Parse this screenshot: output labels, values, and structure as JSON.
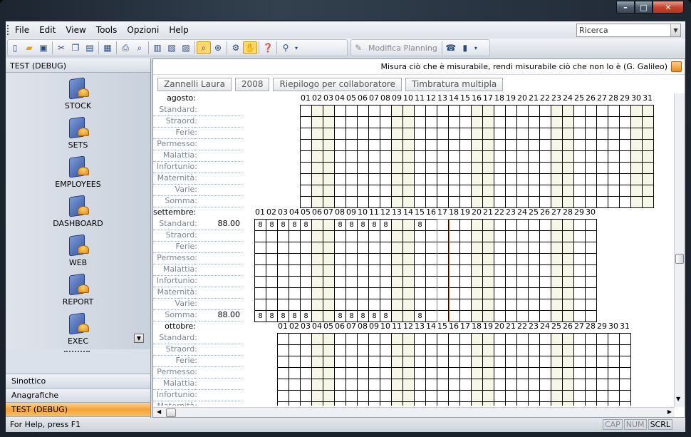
{
  "window": {
    "title": ""
  },
  "menu": [
    "File",
    "Edit",
    "View",
    "Tools",
    "Opzioni",
    "Help"
  ],
  "search": {
    "value": "Ricerca"
  },
  "toolbar": {
    "modifica_planning": "Modifica Planning"
  },
  "left": {
    "header": "TEST (DEBUG)",
    "items": [
      "STOCK",
      "SETS",
      "EMPLOYEES",
      "DASHBOARD",
      "WEB",
      "REPORT",
      "EXEC"
    ],
    "nav": [
      "Sinottico",
      "Anagrafiche",
      "TEST (DEBUG)"
    ],
    "footer": "»"
  },
  "main": {
    "quote": "Misura ciò che è misurabile, rendi misurabile ciò che non lo è (G. Galileo)",
    "buttons": [
      "Zannelli Laura",
      "2008",
      "Riepilogo per collaboratore",
      "Timbratura multipla"
    ],
    "row_labels": [
      "Standard:",
      "Straord:",
      "Ferie:",
      "Permesso:",
      "Malattia:",
      "Infortunio:",
      "Maternità:",
      "Varie:",
      "Somma:"
    ],
    "months": [
      {
        "name": "agosto:",
        "days": 31,
        "standard_total": "",
        "somma_total": "",
        "weekend": [
          2,
          3,
          9,
          10,
          16,
          17,
          23,
          24,
          30,
          31
        ],
        "today": null,
        "values": {}
      },
      {
        "name": "settembre:",
        "days": 30,
        "standard_total": "88.00",
        "somma_total": "88.00",
        "weekend": [
          6,
          7,
          13,
          14,
          20,
          21,
          27,
          28
        ],
        "today": 17,
        "values": {
          "1": "8",
          "2": "8",
          "3": "8",
          "4": "8",
          "5": "8",
          "8": "8",
          "9": "8",
          "10": "8",
          "11": "8",
          "12": "8",
          "15": "8"
        }
      },
      {
        "name": "ottobre:",
        "days": 31,
        "standard_total": "",
        "somma_total": "",
        "weekend": [
          4,
          5,
          11,
          12,
          18,
          19,
          25,
          26
        ],
        "today": null,
        "values": {}
      }
    ]
  },
  "status": {
    "help": "For Help, press F1",
    "cap": "CAP",
    "num": "NUM",
    "scrl": "SCRL"
  }
}
